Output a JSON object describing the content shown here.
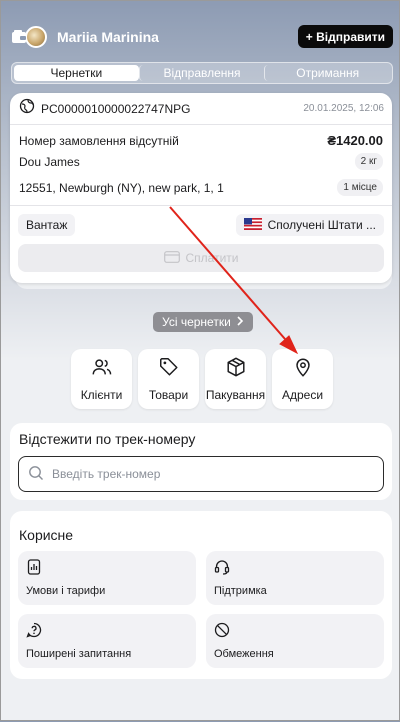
{
  "header": {
    "username": "Mariia Marinina",
    "send_label": "+ Відправити"
  },
  "tabs": [
    {
      "label": "Чернетки",
      "active": true
    },
    {
      "label": "Відправлення",
      "active": false
    },
    {
      "label": "Отримання",
      "active": false
    }
  ],
  "order": {
    "code": "PC0000010000022747NPG",
    "date": "20.01.2025, 12:06",
    "order_number": "Номер замовлення відсутній",
    "price": "₴1420.00",
    "recipient": "Dou James",
    "weight": "2 кг",
    "address": "12551, Newburgh (NY), new park, 1, 1",
    "places": "1 місце",
    "cargo_type": "Вантаж",
    "country": "Сполучені Штати ...",
    "pay_label": "Сплатити"
  },
  "all_drafts_label": "Усі чернетки",
  "quick_actions": [
    {
      "label": "Клієнти",
      "icon": "users-icon"
    },
    {
      "label": "Товари",
      "icon": "tag-icon"
    },
    {
      "label": "Пакування",
      "icon": "box-icon"
    },
    {
      "label": "Адреси",
      "icon": "map-pin-icon"
    }
  ],
  "track": {
    "title": "Відстежити по трек-номеру",
    "placeholder": "Введіть трек-номер"
  },
  "useful": {
    "title": "Корисне",
    "items": [
      {
        "label": "Умови і тарифи",
        "icon": "chart-doc-icon"
      },
      {
        "label": "Підтримка",
        "icon": "headset-icon"
      },
      {
        "label": "Поширені запитання",
        "icon": "question-icon"
      },
      {
        "label": "Обмеження",
        "icon": "prohibited-icon"
      }
    ]
  },
  "colors": {
    "accent_arrow": "#e0241b",
    "send_button": "#0b0b0b",
    "header_gradient_top": "#8d9bb3"
  }
}
